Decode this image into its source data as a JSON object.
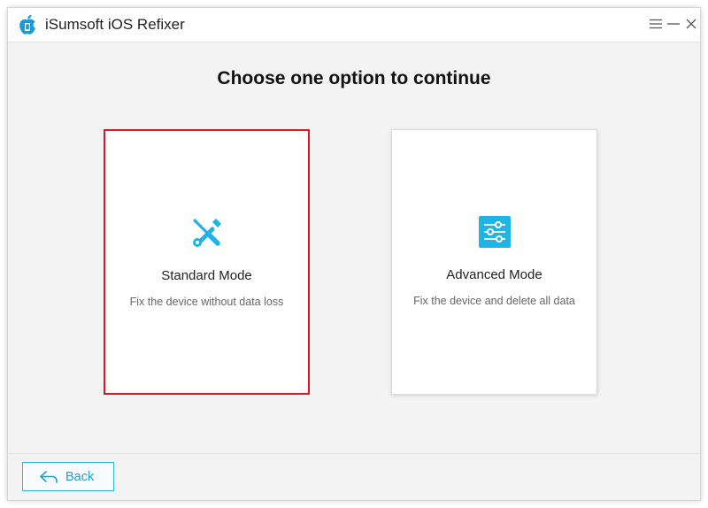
{
  "app": {
    "title": "iSumsoft iOS Refixer"
  },
  "window_controls": {
    "menu_icon": "hamburger-icon",
    "minimize_icon": "minimize-icon",
    "close_icon": "close-icon"
  },
  "main": {
    "heading": "Choose one option to continue",
    "modes": [
      {
        "title": "Standard Mode",
        "description": "Fix the device without data loss",
        "icon": "wrench-screwdriver-icon",
        "selected": true
      },
      {
        "title": "Advanced Mode",
        "description": "Fix the device and delete all data",
        "icon": "sliders-icon",
        "selected": false
      }
    ]
  },
  "footer": {
    "back_label": "Back",
    "back_icon": "back-arrow-icon"
  },
  "colors": {
    "accent": "#2bb8e8",
    "selected_border": "#e0141e",
    "window_bg": "#f3f3f3",
    "card_bg": "#ffffff"
  }
}
